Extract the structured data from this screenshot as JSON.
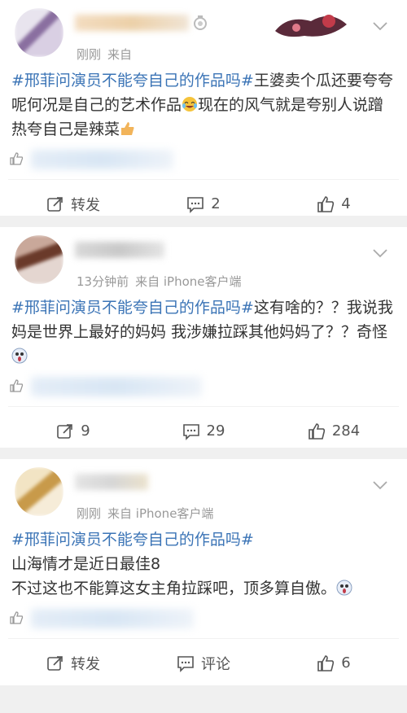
{
  "posts": [
    {
      "meta_time": "刚刚",
      "meta_source": "来自",
      "tag": "#邢菲问演员不能夸自己的作品吗#",
      "body_a": "王婆卖个瓜还要夸夸呢何况是自己的艺术作品",
      "body_b": "现在的风气就是夸别人说蹭热夸自己是辣菜",
      "actions": {
        "repost": "转发",
        "comment": "2",
        "like": "4"
      }
    },
    {
      "meta_time": "13分钟前",
      "meta_source": "来自 iPhone客户端",
      "tag": "#邢菲问演员不能夸自己的作品吗#",
      "body_a": "这有啥的？？我说我妈是世界上最好的妈妈 我涉嫌拉踩其他妈妈了？？奇怪",
      "actions": {
        "repost": "9",
        "comment": "29",
        "like": "284"
      }
    },
    {
      "meta_time": "刚刚",
      "meta_source": "来自 iPhone客户端",
      "tag": "#邢菲问演员不能夸自己的作品吗#",
      "line2": "山海情才是近日最佳8",
      "line3": "不过这也不能算这女主角拉踩吧，顶多算自傲。",
      "actions": {
        "repost": "转发",
        "comment": "评论",
        "like": "6"
      }
    }
  ],
  "colors": {
    "link": "#3b74b6",
    "meta": "#999999",
    "background": "#f0f0f0"
  }
}
